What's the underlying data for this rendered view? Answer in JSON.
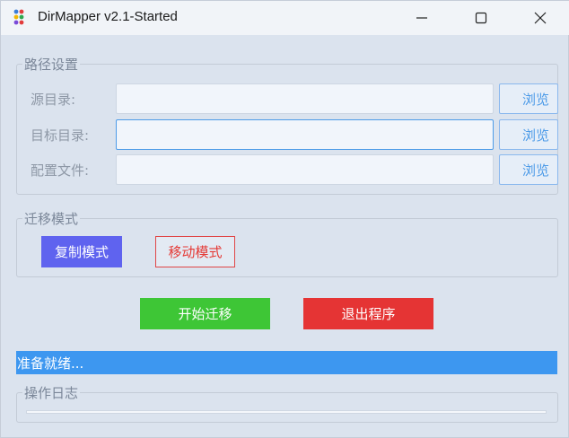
{
  "window": {
    "title": "DirMapper v2.1-Started"
  },
  "path_settings": {
    "group_title": "路径设置",
    "rows": [
      {
        "label": "源目录:",
        "value": "",
        "browse_label": "浏览"
      },
      {
        "label": "目标目录:",
        "value": "",
        "browse_label": "浏览"
      },
      {
        "label": "配置文件:",
        "value": "",
        "browse_label": "浏览"
      }
    ]
  },
  "migration_mode": {
    "group_title": "迁移模式",
    "copy_label": "复制模式",
    "move_label": "移动模式",
    "selected": "复制模式"
  },
  "actions": {
    "start_label": "开始迁移",
    "exit_label": "退出程序"
  },
  "status": {
    "text": "准备就绪..."
  },
  "log": {
    "group_title": "操作日志"
  },
  "colors": {
    "copy_mode_bg": "#5f63ef",
    "move_mode_text": "#e53935",
    "start_bg": "#3ec636",
    "exit_bg": "#e53434",
    "status_bg": "#3d97f0",
    "accent": "#4d9be8"
  },
  "icons": {
    "app": "dirmapper-app-icon",
    "minimize": "minimize-icon",
    "maximize": "maximize-icon",
    "close": "close-icon"
  }
}
